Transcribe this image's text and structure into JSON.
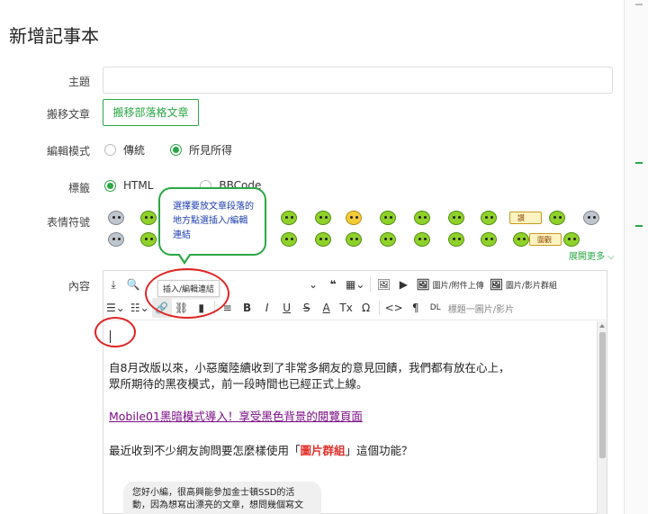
{
  "page": {
    "title": "新增記事本"
  },
  "form": {
    "subject_label": "主題",
    "subject_value": "",
    "move_label": "搬移文章",
    "move_button": "搬移部落格文章",
    "edit_mode_label": "編輯模式",
    "edit_mode_options": [
      "傳統",
      "所見所得"
    ],
    "edit_mode_selected": "所見所得",
    "markup_label": "標籤",
    "markup_options": [
      "HTML",
      "BBCode"
    ],
    "markup_selected": "HTML",
    "emoji_label": "表情符號",
    "expand_more": "展開更多 ⌵",
    "content_label": "內容"
  },
  "emojis": [
    "smile",
    "angry",
    "surprised",
    "sad",
    "wink",
    "laugh",
    "shocked",
    "cool",
    "grin",
    "happy",
    "cry",
    "idea",
    "thumbs-up",
    "box",
    "think"
  ],
  "emoji_box_texts": [
    "讚",
    "圍觀"
  ],
  "annotation": {
    "bubble_text": "選擇要放文章段落的地方點選插入/編輯連結"
  },
  "toolbar": {
    "row1": {
      "hover_tip": "插入/編輯連結",
      "quote": "❝",
      "image_attachment": "圖片/附件上傳",
      "image_group": "圖片/影片群組"
    },
    "row2": {
      "bold": "B",
      "italic": "I",
      "underline": "U",
      "strike": "S",
      "font_color": "A",
      "clear_format": "Tx",
      "omega": "Ω",
      "code": "<>",
      "paragraph": "¶",
      "dl": "DL",
      "caption_placeholder": "標題一圖片/影片"
    }
  },
  "content": {
    "line1": "自8月改版以來，小惡魔陸續收到了非常多網友的意見回饋，我們都有放在心上，",
    "line2": "眾所期待的黑夜模式，前一段時間也已經正式上線。",
    "link": "Mobile01黑暗模式導入！享受黑色背景的閱覽頁面",
    "line3_pre": "最近收到不少網友詢問要怎麼樣使用「",
    "line3_bold": "圖片群組",
    "line3_post": "」這個功能？",
    "chat_line1": "您好小編，很高興能參加金士頓SSD的活",
    "chat_line2": "動，因為想寫出漂亮的文章，想問幾個寫文"
  },
  "colors": {
    "accent": "#2aa845",
    "link": "#7b0c86",
    "highlight": "#e0312b",
    "annotation": "#e02424"
  }
}
